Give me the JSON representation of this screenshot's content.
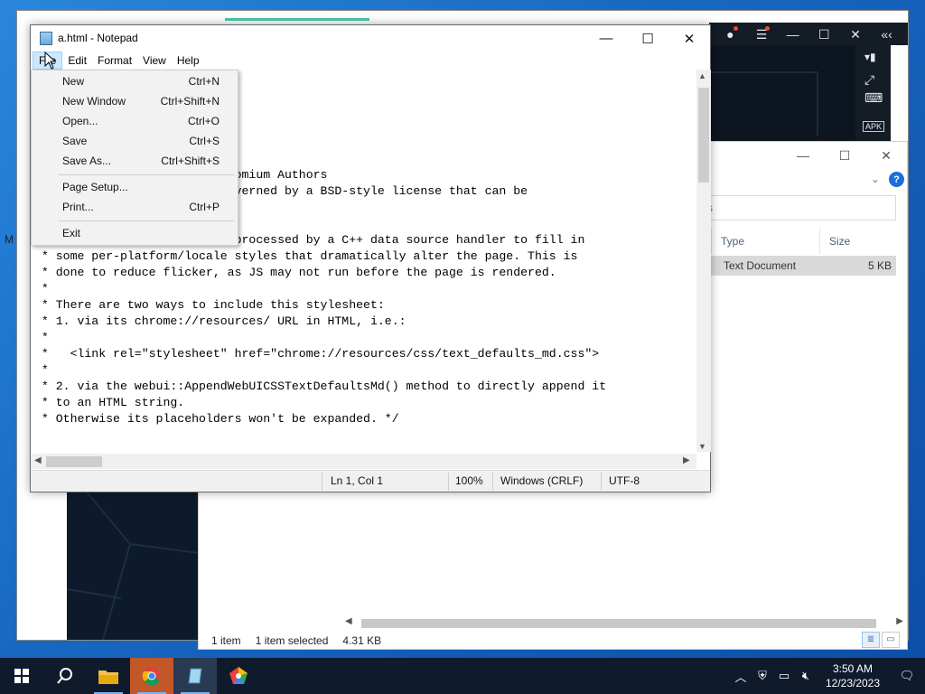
{
  "notepad": {
    "title": "a.html - Notepad",
    "menu": [
      "File",
      "Edit",
      "Format",
      "View",
      "Help"
    ],
    "file_menu": [
      {
        "label": "New",
        "shortcut": "Ctrl+N"
      },
      {
        "label": "New Window",
        "shortcut": "Ctrl+Shift+N"
      },
      {
        "label": "Open...",
        "shortcut": "Ctrl+O"
      },
      {
        "label": "Save",
        "shortcut": "Ctrl+S"
      },
      {
        "label": "Save As...",
        "shortcut": "Ctrl+Shift+S"
      },
      {
        "label": "Page Setup...",
        "shortcut": ""
      },
      {
        "label": "Print...",
        "shortcut": "Ctrl+P"
      },
      {
        "label": "Exit",
        "shortcut": ""
      }
    ],
    "text_lines": [
      "",
      "",
      "",
      "",
      "                        le>",
      "",
      "                         Chromium Authors",
      "                        s governed by a BSD-style license that can be",
      "                        . */",
      "",
      "/* This file is dynamically processed by a C++ data source handler to fill in",
      " * some per-platform/locale styles that dramatically alter the page. This is",
      " * done to reduce flicker, as JS may not run before the page is rendered.",
      " *",
      " * There are two ways to include this stylesheet:",
      " * 1. via its chrome://resources/ URL in HTML, i.e.:",
      " *",
      " *   <link rel=\"stylesheet\" href=\"chrome://resources/css/text_defaults_md.css\">",
      " *",
      " * 2. via the webui::AppendWebUICSSTextDefaultsMd() method to directly append it",
      " * to an HTML string.",
      " * Otherwise its placeholders won't be expanded. */"
    ],
    "status": {
      "position": "Ln 1, Col 1",
      "zoom": "100%",
      "line_ending": "Windows (CRLF)",
      "encoding": "UTF-8"
    }
  },
  "explorer": {
    "search_partial": "s",
    "columns": [
      "Type",
      "Size"
    ],
    "row": {
      "type": "Text Document",
      "size": "5 KB"
    },
    "status_items": "1 item",
    "status_selected": "1 item selected",
    "status_size": "4.31 KB"
  },
  "left_window": {
    "side_letter": "M"
  },
  "taskbar": {
    "time": "3:50 AM",
    "date": "12/23/2023"
  },
  "colors": {
    "taskbar": "#0f1b2d",
    "menu_highlight": "#cce8ff",
    "desktop": "#1b6fc4"
  }
}
